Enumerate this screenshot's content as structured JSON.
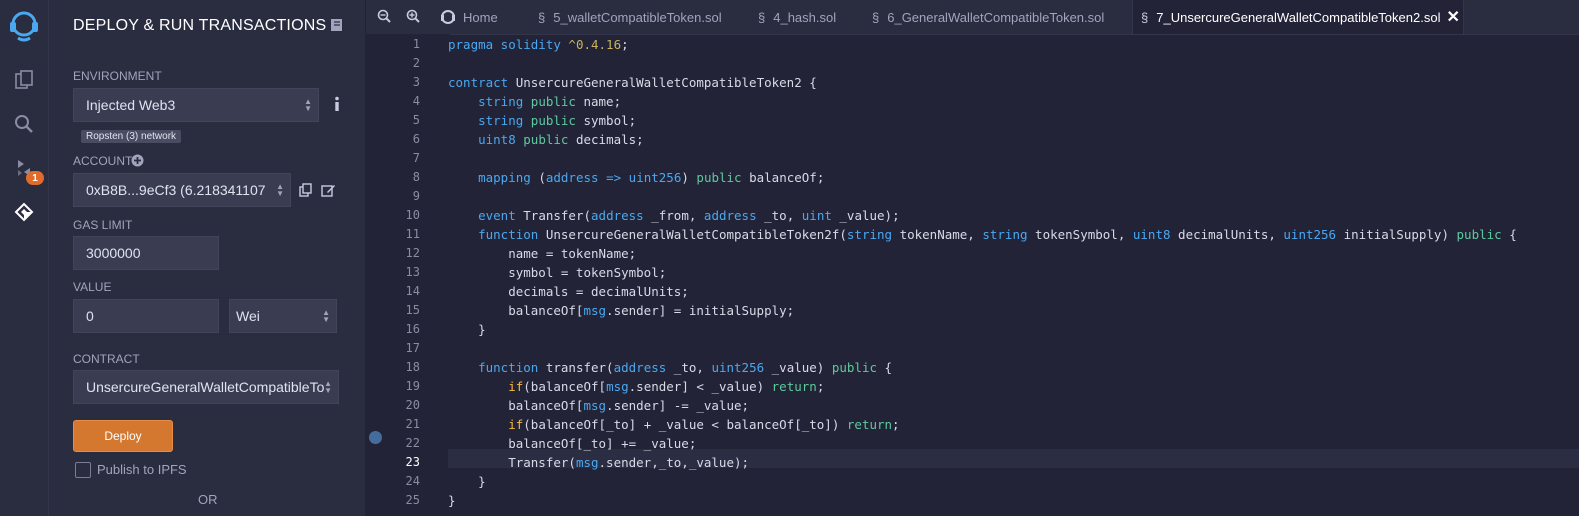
{
  "panel": {
    "title": "DEPLOY & RUN TRANSACTIONS",
    "environment_label": "ENVIRONMENT",
    "environment_value": "Injected Web3",
    "network_badge": "Ropsten (3) network",
    "account_label": "ACCOUNT",
    "account_value": "0xB8B...9eCf3 (6.218341107",
    "gas_limit_label": "GAS LIMIT",
    "gas_limit_value": "3000000",
    "value_label": "VALUE",
    "value_amount": "0",
    "value_unit": "Wei",
    "contract_label": "CONTRACT",
    "contract_value": "UnsercureGeneralWalletCompatibleTo",
    "deploy_label": "Deploy",
    "publish_label": "Publish to IPFS",
    "or_label": "OR"
  },
  "rail": {
    "plugin_badge": "1",
    "icons": [
      "remix-logo-icon",
      "file-explorer-icon",
      "search-icon",
      "compiler-icon",
      "deploy-run-icon"
    ]
  },
  "tabs": [
    {
      "label": "Home",
      "icon": "home-icon"
    },
    {
      "label": "5_walletCompatibleToken.sol",
      "icon": "solidity-file-icon"
    },
    {
      "label": "4_hash.sol",
      "icon": "solidity-file-icon"
    },
    {
      "label": "6_GeneralWalletCompatibleToken.sol",
      "icon": "solidity-file-icon"
    },
    {
      "label": "7_UnsercureGeneralWalletCompatibleToken2.sol",
      "icon": "solidity-file-icon",
      "active": true
    }
  ],
  "editor": {
    "current_line": 23,
    "breakpoint_line": 20,
    "line_numbers": [
      "1",
      "2",
      "3",
      "4",
      "5",
      "6",
      "7",
      "8",
      "9",
      "10",
      "11",
      "12",
      "13",
      "14",
      "15",
      "16",
      "17",
      "18",
      "19",
      "20",
      "21",
      "22",
      "23",
      "24",
      "25"
    ],
    "lines": [
      [
        [
          "kw",
          "pragma solidity"
        ],
        [
          "t",
          " "
        ],
        [
          "kv",
          "^0.4.16"
        ],
        [
          "t",
          ";"
        ]
      ],
      [],
      [
        [
          "kw",
          "contract"
        ],
        [
          "t",
          " UnsercureGeneralWalletCompatibleToken2 {"
        ]
      ],
      [
        [
          "t",
          "    "
        ],
        [
          "kw",
          "string"
        ],
        [
          "t",
          " "
        ],
        [
          "kg",
          "public"
        ],
        [
          "t",
          " name;"
        ]
      ],
      [
        [
          "t",
          "    "
        ],
        [
          "kw",
          "string"
        ],
        [
          "t",
          " "
        ],
        [
          "kg",
          "public"
        ],
        [
          "t",
          " symbol;"
        ]
      ],
      [
        [
          "t",
          "    "
        ],
        [
          "kw",
          "uint8"
        ],
        [
          "t",
          " "
        ],
        [
          "kg",
          "public"
        ],
        [
          "t",
          " decimals;"
        ]
      ],
      [],
      [
        [
          "t",
          "    "
        ],
        [
          "kw",
          "mapping"
        ],
        [
          "t",
          " ("
        ],
        [
          "kw",
          "address"
        ],
        [
          "t",
          " "
        ],
        [
          "kw",
          "=>"
        ],
        [
          "t",
          " "
        ],
        [
          "kw",
          "uint256"
        ],
        [
          "t",
          ") "
        ],
        [
          "kg",
          "public"
        ],
        [
          "t",
          " balanceOf;"
        ]
      ],
      [],
      [
        [
          "t",
          "    "
        ],
        [
          "kw",
          "event"
        ],
        [
          "t",
          " Transfer("
        ],
        [
          "kw",
          "address"
        ],
        [
          "t",
          " _from, "
        ],
        [
          "kw",
          "address"
        ],
        [
          "t",
          " _to, "
        ],
        [
          "kw",
          "uint"
        ],
        [
          "t",
          " _value);"
        ]
      ],
      [
        [
          "t",
          "    "
        ],
        [
          "kw",
          "function"
        ],
        [
          "t",
          " UnsercureGeneralWalletCompatibleToken2f("
        ],
        [
          "kw",
          "string"
        ],
        [
          "t",
          " tokenName, "
        ],
        [
          "kw",
          "string"
        ],
        [
          "t",
          " tokenSymbol, "
        ],
        [
          "kw",
          "uint8"
        ],
        [
          "t",
          " decimalUnits, "
        ],
        [
          "kw",
          "uint256"
        ],
        [
          "t",
          " initialSupply) "
        ],
        [
          "kg",
          "public"
        ],
        [
          "t",
          " {"
        ]
      ],
      [
        [
          "t",
          "        name = tokenName;"
        ]
      ],
      [
        [
          "t",
          "        symbol = tokenSymbol;"
        ]
      ],
      [
        [
          "t",
          "        decimals = decimalUnits;"
        ]
      ],
      [
        [
          "t",
          "        balanceOf["
        ],
        [
          "kw",
          "msg"
        ],
        [
          "t",
          ".sender] = initialSupply;"
        ]
      ],
      [
        [
          "t",
          "    }"
        ]
      ],
      [],
      [
        [
          "t",
          "    "
        ],
        [
          "kw",
          "function"
        ],
        [
          "t",
          " transfer("
        ],
        [
          "kw",
          "address"
        ],
        [
          "t",
          " _to, "
        ],
        [
          "kw",
          "uint256"
        ],
        [
          "t",
          " _value) "
        ],
        [
          "kg",
          "public"
        ],
        [
          "t",
          " {"
        ]
      ],
      [
        [
          "t",
          "        "
        ],
        [
          "ko",
          "if"
        ],
        [
          "t",
          "(balanceOf["
        ],
        [
          "kw",
          "msg"
        ],
        [
          "t",
          ".sender] < _value) "
        ],
        [
          "kg",
          "return"
        ],
        [
          "t",
          ";"
        ]
      ],
      [
        [
          "t",
          "        balanceOf["
        ],
        [
          "kw",
          "msg"
        ],
        [
          "t",
          ".sender] -= _value;"
        ]
      ],
      [
        [
          "t",
          "        "
        ],
        [
          "ko",
          "if"
        ],
        [
          "t",
          "(balanceOf[_to] + _value < balanceOf[_to]) "
        ],
        [
          "kg",
          "return"
        ],
        [
          "t",
          ";"
        ]
      ],
      [
        [
          "t",
          "        balanceOf[_to] += _value;"
        ]
      ],
      [
        [
          "t",
          "        Transfer("
        ],
        [
          "kw",
          "msg"
        ],
        [
          "t",
          ".sender,_to,_value);"
        ]
      ],
      [
        [
          "t",
          "    }"
        ]
      ],
      [
        [
          "t",
          "}"
        ]
      ]
    ]
  },
  "colors": {
    "accent": "#d4782f",
    "keyword": "#4aa8f0",
    "modifier": "#5ec99e",
    "control": "#f5b842",
    "version": "#c9b35f"
  }
}
